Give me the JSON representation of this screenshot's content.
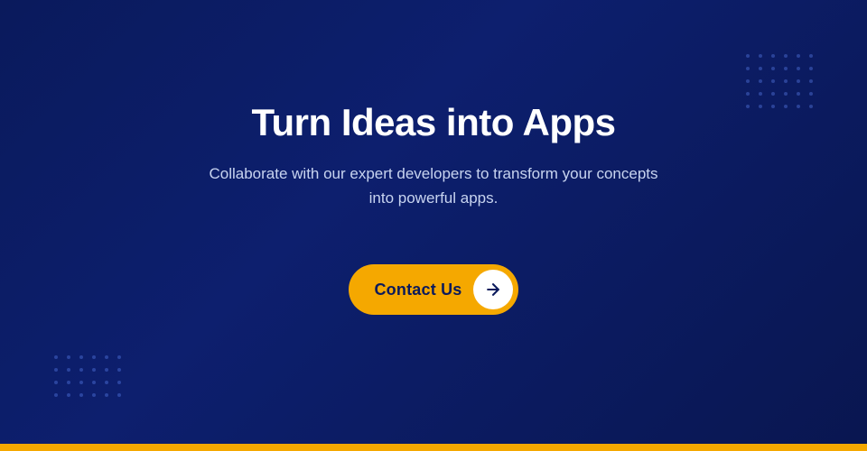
{
  "page": {
    "background_color": "#0d1f6e",
    "bottom_bar_color": "#f5a800"
  },
  "hero": {
    "title": "Turn Ideas into Apps",
    "subtitle": "Collaborate with our expert developers to transform your concepts into powerful apps.",
    "cta_label": "Contact Us",
    "cta_arrow": "→"
  },
  "decorations": {
    "dot_color": "rgba(100, 140, 255, 0.35)",
    "top_right_cols": 6,
    "top_right_rows": 5,
    "bottom_left_cols": 6,
    "bottom_left_rows": 4
  }
}
